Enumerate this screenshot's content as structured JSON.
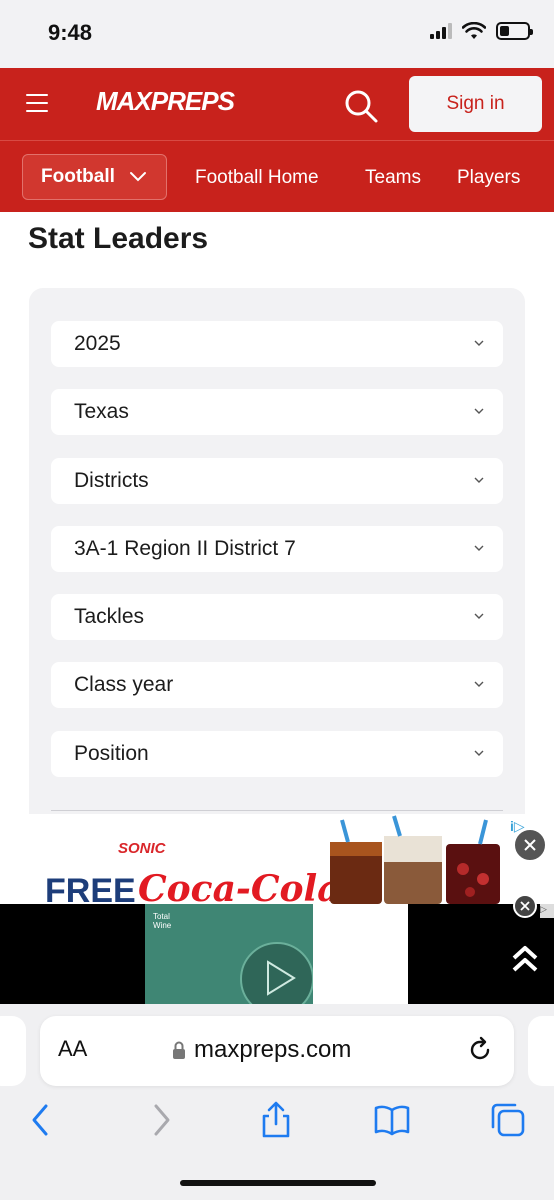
{
  "status_bar": {
    "time": "9:48"
  },
  "header": {
    "logo": "MAXPREPS",
    "signin_label": "Sign in"
  },
  "subnav": {
    "sport": "Football",
    "links": [
      "Football Home",
      "Teams",
      "Players"
    ]
  },
  "page": {
    "title": "Stat Leaders"
  },
  "filters": [
    {
      "label": "2025"
    },
    {
      "label": "Texas"
    },
    {
      "label": "Districts"
    },
    {
      "label": "3A-1 Region II District 7"
    },
    {
      "label": "Tackles"
    },
    {
      "label": "Class year"
    },
    {
      "label": "Position"
    }
  ],
  "ad_top": {
    "brand": "SONIC",
    "headline": "FREE",
    "product": "Coca-Cola"
  },
  "ad_bottom": {
    "brand_line1": "Total",
    "brand_line2": "Wine"
  },
  "safari": {
    "aa_label": "AA",
    "url": "maxpreps.com"
  },
  "colors": {
    "brand_red": "#c8221c",
    "link_blue": "#1e7bf0"
  }
}
